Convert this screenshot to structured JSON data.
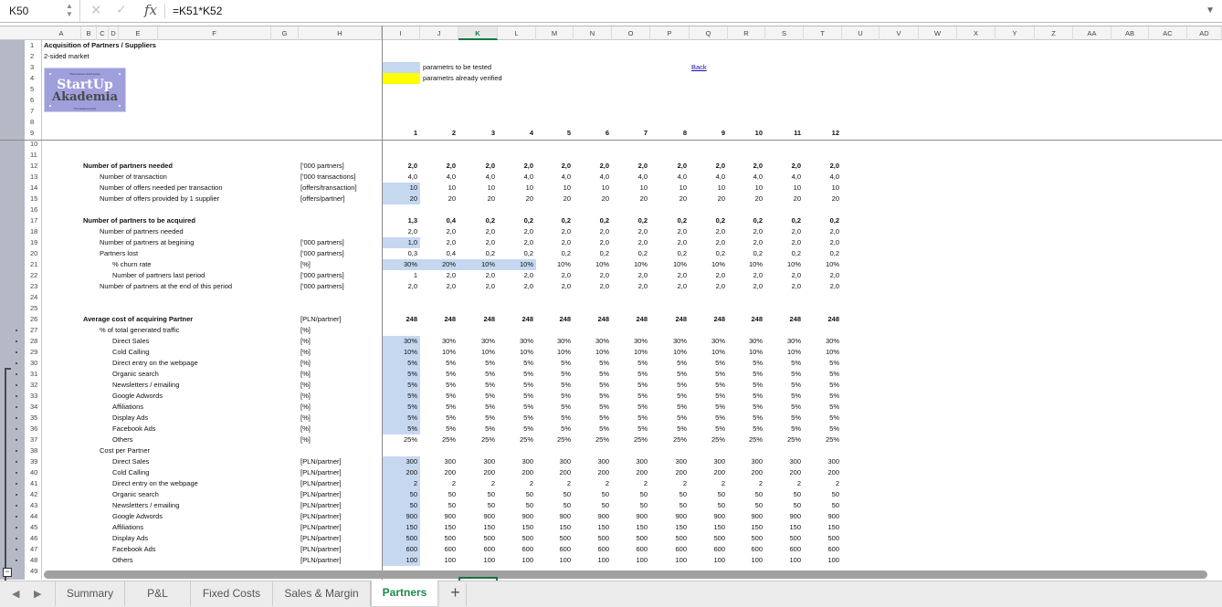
{
  "formula_bar": {
    "name_box": "K50",
    "cancel_icon": "✕",
    "confirm_icon": "✓",
    "fx_label": "fx",
    "formula": "=K51*K52",
    "expand_icon": "▼"
  },
  "outline_levels": [
    "1",
    "2"
  ],
  "columns": [
    "A",
    "B",
    "C",
    "D",
    "E",
    "F",
    "G",
    "H",
    "I",
    "J",
    "K",
    "L",
    "M",
    "N",
    "O",
    "P",
    "Q",
    "R",
    "S",
    "T",
    "U",
    "V",
    "W",
    "X",
    "Y",
    "Z",
    "AA",
    "AB",
    "AC",
    "AD"
  ],
  "selected_column": "K",
  "rows": [
    "1",
    "2",
    "3",
    "4",
    "5",
    "6",
    "7",
    "8",
    "9",
    "10",
    "11",
    "12",
    "13",
    "14",
    "15",
    "16",
    "17",
    "18",
    "19",
    "20",
    "21",
    "22",
    "23",
    "24",
    "25",
    "26",
    "27",
    "28",
    "29",
    "30",
    "31",
    "32",
    "33",
    "34",
    "35",
    "36",
    "37",
    "38",
    "39",
    "40",
    "41",
    "42",
    "43",
    "44",
    "45",
    "46",
    "47",
    "48",
    "49"
  ],
  "header": {
    "title": "Acquisition of Partners / Suppliers",
    "subtitle": "2-sided market",
    "logo": {
      "top": "Warsztatowe StartUpowe",
      "line1": "StartUp",
      "line2": "Akademia",
      "bottom": "Przedsiębiorczość"
    },
    "legend": [
      {
        "label": "parametrs to be tested",
        "color": "#c5d8f0"
      },
      {
        "label": "parametrs already verified",
        "color": "#ffff00"
      }
    ],
    "back_link": "Back"
  },
  "periods": [
    "1",
    "2",
    "3",
    "4",
    "5",
    "6",
    "7",
    "8",
    "9",
    "10",
    "11",
    "12"
  ],
  "table": [
    {
      "row": 12,
      "label": "Number of partners needed",
      "indent": 0,
      "bold": true,
      "unit": "['000 partners]",
      "values": [
        "2,0",
        "2,0",
        "2,0",
        "2,0",
        "2,0",
        "2,0",
        "2,0",
        "2,0",
        "2,0",
        "2,0",
        "2,0",
        "2,0"
      ],
      "blue": 0
    },
    {
      "row": 13,
      "label": "Number of transaction",
      "indent": 1,
      "unit": "['000 transactions]",
      "values": [
        "4,0",
        "4,0",
        "4,0",
        "4,0",
        "4,0",
        "4,0",
        "4,0",
        "4,0",
        "4,0",
        "4,0",
        "4,0",
        "4,0"
      ],
      "blue": 0
    },
    {
      "row": 14,
      "label": "Number of offers needed per transaction",
      "indent": 1,
      "unit": "[offers/transaction]",
      "values": [
        "10",
        "10",
        "10",
        "10",
        "10",
        "10",
        "10",
        "10",
        "10",
        "10",
        "10",
        "10"
      ],
      "blue": 1
    },
    {
      "row": 15,
      "label": "Number of offers provided by 1 supplier",
      "indent": 1,
      "unit": "[offers/partner]",
      "values": [
        "20",
        "20",
        "20",
        "20",
        "20",
        "20",
        "20",
        "20",
        "20",
        "20",
        "20",
        "20"
      ],
      "blue": 1
    },
    {
      "row": 17,
      "label": "Number of partners to be acquired",
      "indent": 0,
      "bold": true,
      "unit": "",
      "values": [
        "1,3",
        "0,4",
        "0,2",
        "0,2",
        "0,2",
        "0,2",
        "0,2",
        "0,2",
        "0,2",
        "0,2",
        "0,2",
        "0,2"
      ],
      "blue": 0
    },
    {
      "row": 18,
      "label": "Number of partners needed",
      "indent": 1,
      "unit": "",
      "values": [
        "2,0",
        "2,0",
        "2,0",
        "2,0",
        "2,0",
        "2,0",
        "2,0",
        "2,0",
        "2,0",
        "2,0",
        "2,0",
        "2,0"
      ],
      "blue": 0
    },
    {
      "row": 19,
      "label": "Number of partners at begining",
      "indent": 1,
      "unit": "['000 partners]",
      "values": [
        "1,0",
        "2,0",
        "2,0",
        "2,0",
        "2,0",
        "2,0",
        "2,0",
        "2,0",
        "2,0",
        "2,0",
        "2,0",
        "2,0"
      ],
      "blue": 1
    },
    {
      "row": 20,
      "label": "Partners lost",
      "indent": 1,
      "unit": "['000 partners]",
      "values": [
        "0,3",
        "0,4",
        "0,2",
        "0,2",
        "0,2",
        "0,2",
        "0,2",
        "0,2",
        "0,2",
        "0,2",
        "0,2",
        "0,2"
      ],
      "blue": 0
    },
    {
      "row": 21,
      "label": "% churn rate",
      "indent": 2,
      "unit": "[%]",
      "values": [
        "30%",
        "20%",
        "10%",
        "10%",
        "10%",
        "10%",
        "10%",
        "10%",
        "10%",
        "10%",
        "10%",
        "10%"
      ],
      "blue": 4
    },
    {
      "row": 22,
      "label": "Number of partners last period",
      "indent": 2,
      "unit": "['000 partners]",
      "values": [
        "1",
        "2,0",
        "2,0",
        "2,0",
        "2,0",
        "2,0",
        "2,0",
        "2,0",
        "2,0",
        "2,0",
        "2,0",
        "2,0"
      ],
      "blue": 0
    },
    {
      "row": 23,
      "label": "Number of partners at the end of this period",
      "indent": 1,
      "unit": "['000 partners]",
      "values": [
        "2,0",
        "2,0",
        "2,0",
        "2,0",
        "2,0",
        "2,0",
        "2,0",
        "2,0",
        "2,0",
        "2,0",
        "2,0",
        "2,0"
      ],
      "blue": 0
    },
    {
      "row": 26,
      "label": "Average cost of acquiring Partner",
      "indent": 0,
      "bold": true,
      "unit": "[PLN/partner]",
      "values": [
        "248",
        "248",
        "248",
        "248",
        "248",
        "248",
        "248",
        "248",
        "248",
        "248",
        "248",
        "248"
      ],
      "blue": 0
    },
    {
      "row": 27,
      "label": "% of total generated traffic",
      "indent": 1,
      "unit": "[%]",
      "values": [],
      "blue": 0
    },
    {
      "row": 28,
      "label": "Direct Sales",
      "indent": 2,
      "unit": "[%]",
      "values": [
        "30%",
        "30%",
        "30%",
        "30%",
        "30%",
        "30%",
        "30%",
        "30%",
        "30%",
        "30%",
        "30%",
        "30%"
      ],
      "blue": 1
    },
    {
      "row": 29,
      "label": "Cold Calling",
      "indent": 2,
      "unit": "[%]",
      "values": [
        "10%",
        "10%",
        "10%",
        "10%",
        "10%",
        "10%",
        "10%",
        "10%",
        "10%",
        "10%",
        "10%",
        "10%"
      ],
      "blue": 1
    },
    {
      "row": 30,
      "label": "Direct entry on the webpage",
      "indent": 2,
      "unit": "[%]",
      "values": [
        "5%",
        "5%",
        "5%",
        "5%",
        "5%",
        "5%",
        "5%",
        "5%",
        "5%",
        "5%",
        "5%",
        "5%"
      ],
      "blue": 1
    },
    {
      "row": 31,
      "label": "Organic search",
      "indent": 2,
      "unit": "[%]",
      "values": [
        "5%",
        "5%",
        "5%",
        "5%",
        "5%",
        "5%",
        "5%",
        "5%",
        "5%",
        "5%",
        "5%",
        "5%"
      ],
      "blue": 1
    },
    {
      "row": 32,
      "label": "Newsletters / emailing",
      "indent": 2,
      "unit": "[%]",
      "values": [
        "5%",
        "5%",
        "5%",
        "5%",
        "5%",
        "5%",
        "5%",
        "5%",
        "5%",
        "5%",
        "5%",
        "5%"
      ],
      "blue": 1
    },
    {
      "row": 33,
      "label": "Google Adwords",
      "indent": 2,
      "unit": "[%]",
      "values": [
        "5%",
        "5%",
        "5%",
        "5%",
        "5%",
        "5%",
        "5%",
        "5%",
        "5%",
        "5%",
        "5%",
        "5%"
      ],
      "blue": 1
    },
    {
      "row": 34,
      "label": "Affiliations",
      "indent": 2,
      "unit": "[%]",
      "values": [
        "5%",
        "5%",
        "5%",
        "5%",
        "5%",
        "5%",
        "5%",
        "5%",
        "5%",
        "5%",
        "5%",
        "5%"
      ],
      "blue": 1
    },
    {
      "row": 35,
      "label": "Display Ads",
      "indent": 2,
      "unit": "[%]",
      "values": [
        "5%",
        "5%",
        "5%",
        "5%",
        "5%",
        "5%",
        "5%",
        "5%",
        "5%",
        "5%",
        "5%",
        "5%"
      ],
      "blue": 1
    },
    {
      "row": 36,
      "label": "Facebook Ads",
      "indent": 2,
      "unit": "[%]",
      "values": [
        "5%",
        "5%",
        "5%",
        "5%",
        "5%",
        "5%",
        "5%",
        "5%",
        "5%",
        "5%",
        "5%",
        "5%"
      ],
      "blue": 1
    },
    {
      "row": 37,
      "label": "Others",
      "indent": 2,
      "unit": "[%]",
      "values": [
        "25%",
        "25%",
        "25%",
        "25%",
        "25%",
        "25%",
        "25%",
        "25%",
        "25%",
        "25%",
        "25%",
        "25%"
      ],
      "blue": 0
    },
    {
      "row": 38,
      "label": "Cost per Partner",
      "indent": 1,
      "unit": "",
      "values": [],
      "blue": 0
    },
    {
      "row": 39,
      "label": "Direct Sales",
      "indent": 2,
      "unit": "[PLN/partner]",
      "values": [
        "300",
        "300",
        "300",
        "300",
        "300",
        "300",
        "300",
        "300",
        "300",
        "300",
        "300",
        "300"
      ],
      "blue": 1
    },
    {
      "row": 40,
      "label": "Cold Calling",
      "indent": 2,
      "unit": "[PLN/partner]",
      "values": [
        "200",
        "200",
        "200",
        "200",
        "200",
        "200",
        "200",
        "200",
        "200",
        "200",
        "200",
        "200"
      ],
      "blue": 1
    },
    {
      "row": 41,
      "label": "Direct entry on the webpage",
      "indent": 2,
      "unit": "[PLN/partner]",
      "values": [
        "2",
        "2",
        "2",
        "2",
        "2",
        "2",
        "2",
        "2",
        "2",
        "2",
        "2",
        "2"
      ],
      "blue": 1
    },
    {
      "row": 42,
      "label": "Organic search",
      "indent": 2,
      "unit": "[PLN/partner]",
      "values": [
        "50",
        "50",
        "50",
        "50",
        "50",
        "50",
        "50",
        "50",
        "50",
        "50",
        "50",
        "50"
      ],
      "blue": 1
    },
    {
      "row": 43,
      "label": "Newsletters / emailing",
      "indent": 2,
      "unit": "[PLN/partner]",
      "values": [
        "50",
        "50",
        "50",
        "50",
        "50",
        "50",
        "50",
        "50",
        "50",
        "50",
        "50",
        "50"
      ],
      "blue": 1
    },
    {
      "row": 44,
      "label": "Google Adwords",
      "indent": 2,
      "unit": "[PLN/partner]",
      "values": [
        "900",
        "900",
        "900",
        "900",
        "900",
        "900",
        "900",
        "900",
        "900",
        "900",
        "900",
        "900"
      ],
      "blue": 1
    },
    {
      "row": 45,
      "label": "Affiliations",
      "indent": 2,
      "unit": "[PLN/partner]",
      "values": [
        "150",
        "150",
        "150",
        "150",
        "150",
        "150",
        "150",
        "150",
        "150",
        "150",
        "150",
        "150"
      ],
      "blue": 1
    },
    {
      "row": 46,
      "label": "Display Ads",
      "indent": 2,
      "unit": "[PLN/partner]",
      "values": [
        "500",
        "500",
        "500",
        "500",
        "500",
        "500",
        "500",
        "500",
        "500",
        "500",
        "500",
        "500"
      ],
      "blue": 1
    },
    {
      "row": 47,
      "label": "Facebook Ads",
      "indent": 2,
      "unit": "[PLN/partner]",
      "values": [
        "600",
        "600",
        "600",
        "600",
        "600",
        "600",
        "600",
        "600",
        "600",
        "600",
        "600",
        "600"
      ],
      "blue": 1
    },
    {
      "row": 48,
      "label": "Others",
      "indent": 2,
      "unit": "[PLN/partner]",
      "values": [
        "100",
        "100",
        "100",
        "100",
        "100",
        "100",
        "100",
        "100",
        "100",
        "100",
        "100",
        "100"
      ],
      "blue": 1
    }
  ],
  "sheet_tabs": {
    "prev_icon": "◀",
    "next_icon": "▶",
    "tabs": [
      "Summary",
      "P&L",
      "Fixed Costs",
      "Sales & Margin",
      "Partners"
    ],
    "active": "Partners",
    "add_icon": "+"
  }
}
